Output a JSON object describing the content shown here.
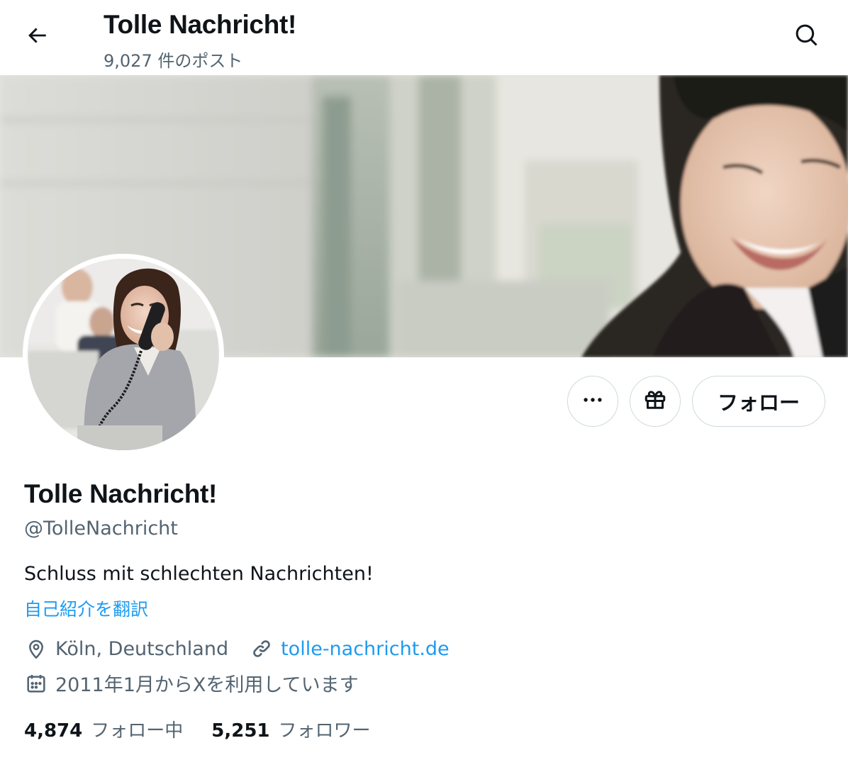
{
  "header": {
    "title": "Tolle Nachricht!",
    "post_count": "9,027 件のポスト"
  },
  "profile": {
    "display_name": "Tolle Nachricht!",
    "handle": "@TolleNachricht",
    "bio": "Schluss mit schlechten Nachrichten!",
    "translate_label": "自己紹介を翻訳",
    "location": "Köln, Deutschland",
    "website": "tolle-nachricht.de",
    "joined": "2011年1月からXを利用しています"
  },
  "actions": {
    "follow_label": "フォロー"
  },
  "stats": {
    "following_count": "4,874",
    "following_label": "フォロー中",
    "followers_count": "5,251",
    "followers_label": "フォロワー"
  },
  "icons": {
    "back": "arrow-left-icon",
    "search": "search-icon",
    "more": "more-horizontal-icon",
    "gift": "gift-icon",
    "location": "location-pin-icon",
    "link": "link-icon",
    "calendar": "calendar-icon"
  },
  "colors": {
    "accent": "#1d9bf0",
    "text_primary": "#0f1419",
    "text_secondary": "#536471",
    "border": "#cfd9de"
  }
}
